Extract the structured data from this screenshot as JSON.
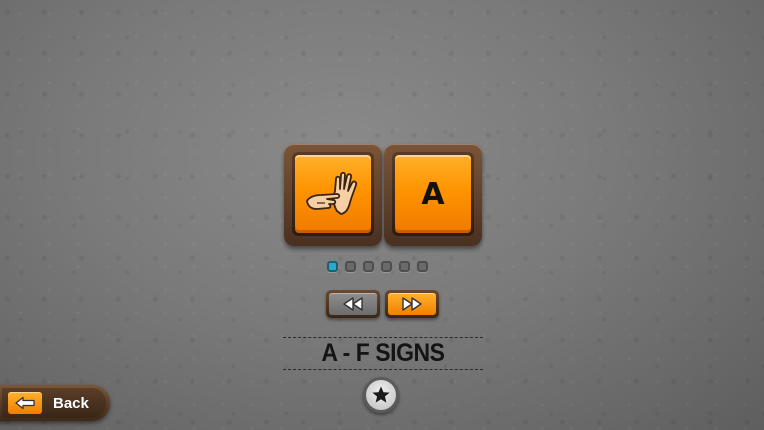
{
  "cards": [
    {
      "type": "image",
      "icon": "hand-sign-icon"
    },
    {
      "type": "letter",
      "letter": "A"
    }
  ],
  "pager": {
    "total": 6,
    "active_index": 0
  },
  "nav": {
    "prev_icon": "rewind-icon",
    "next_icon": "fast-forward-icon"
  },
  "title": "A - F SIGNS",
  "badge": {
    "icon": "star-icon"
  },
  "back": {
    "label": "Back",
    "icon": "arrow-left-icon"
  },
  "colors": {
    "accent_orange": "#ff9400",
    "frame_brown": "#5a3a24",
    "active_dot": "#2aa7c9"
  }
}
